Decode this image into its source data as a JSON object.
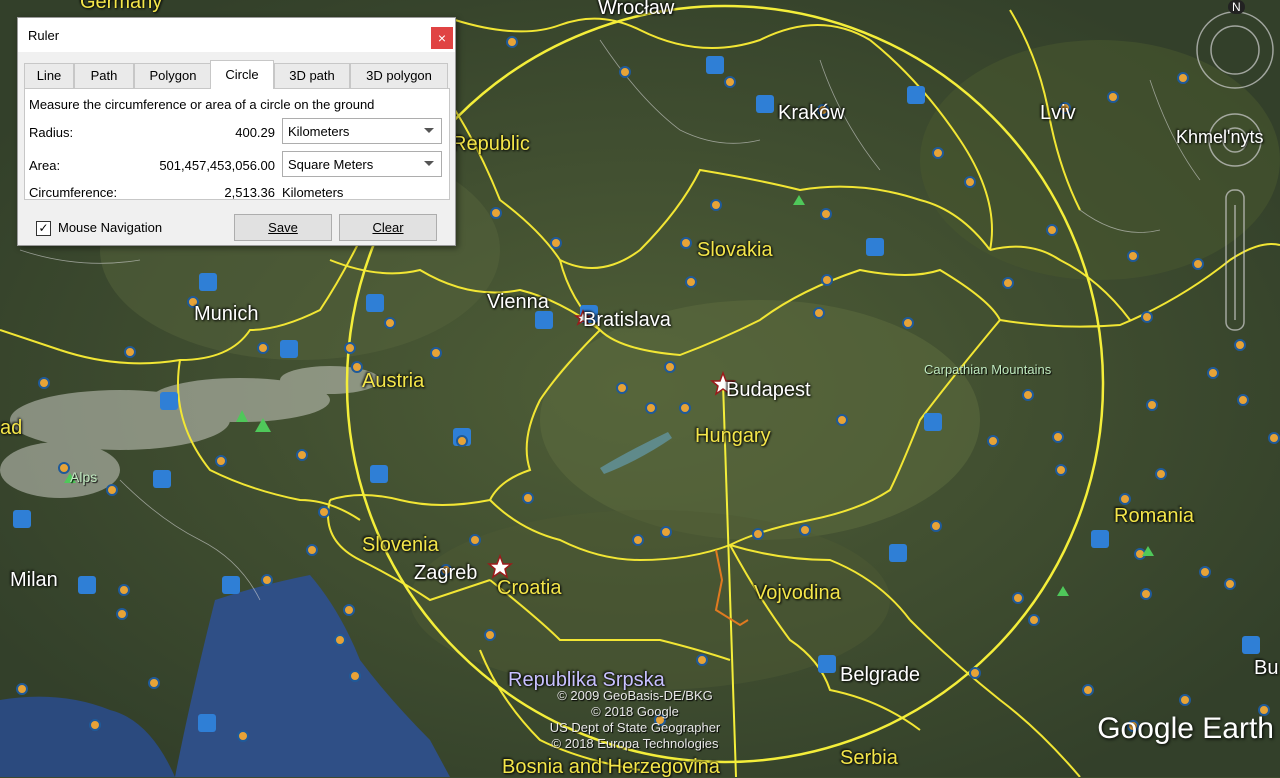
{
  "dialog": {
    "title": "Ruler",
    "close_glyph": "×",
    "tabs": [
      "Line",
      "Path",
      "Polygon",
      "Circle",
      "3D path",
      "3D polygon"
    ],
    "active_tab": "Circle",
    "description": "Measure the circumference or area of a circle on the ground",
    "radius": {
      "label": "Radius:",
      "value": "400.29",
      "unit": "Kilometers"
    },
    "area": {
      "label": "Area:",
      "value": "501,457,453,056.00",
      "unit": "Square Meters"
    },
    "circumference": {
      "label": "Circumference:",
      "value": "2,513.36",
      "unit": "Kilometers"
    },
    "mouse_navigation": {
      "label": "Mouse Navigation",
      "checked": true,
      "check_glyph": "✓"
    },
    "save_label": "Save",
    "clear_label": "Clear"
  },
  "map": {
    "colors": {
      "border": "#f2e634",
      "label_yellow": "#f4e64a",
      "circle": "#f4ee3a"
    },
    "labels": {
      "germany": "Germany",
      "wroclaw": "Wrocław",
      "krakow": "Kraków",
      "lviv": "Lviv",
      "khmelnyts": "Khmel'nyts",
      "republic": "Republic",
      "slovakia": "Slovakia",
      "munich": "Munich",
      "vienna": "Vienna",
      "bratislava": "Bratislava",
      "austria": "Austria",
      "budapest": "Budapest",
      "carpathian": "Carpathian Mountains",
      "hungary": "Hungary",
      "alps": "Alps",
      "ad": "ad",
      "romania": "Romania",
      "slovenia": "Slovenia",
      "zagreb": "Zagreb",
      "croatia": "Croatia",
      "milan": "Milan",
      "vojvodina": "Vojvodina",
      "republika_srpska": "Republika Srpska",
      "belgrade": "Belgrade",
      "serbia": "Serbia",
      "bosnia": "Bosnia and Herzegovina",
      "bu": "Bu"
    },
    "credits": [
      "© 2009 GeoBasis-DE/BKG",
      "© 2018 Google",
      "US Dept of State Geographer",
      "© 2018 Europa Technologies"
    ],
    "brand": "Google Earth",
    "compass_letter": "N"
  }
}
